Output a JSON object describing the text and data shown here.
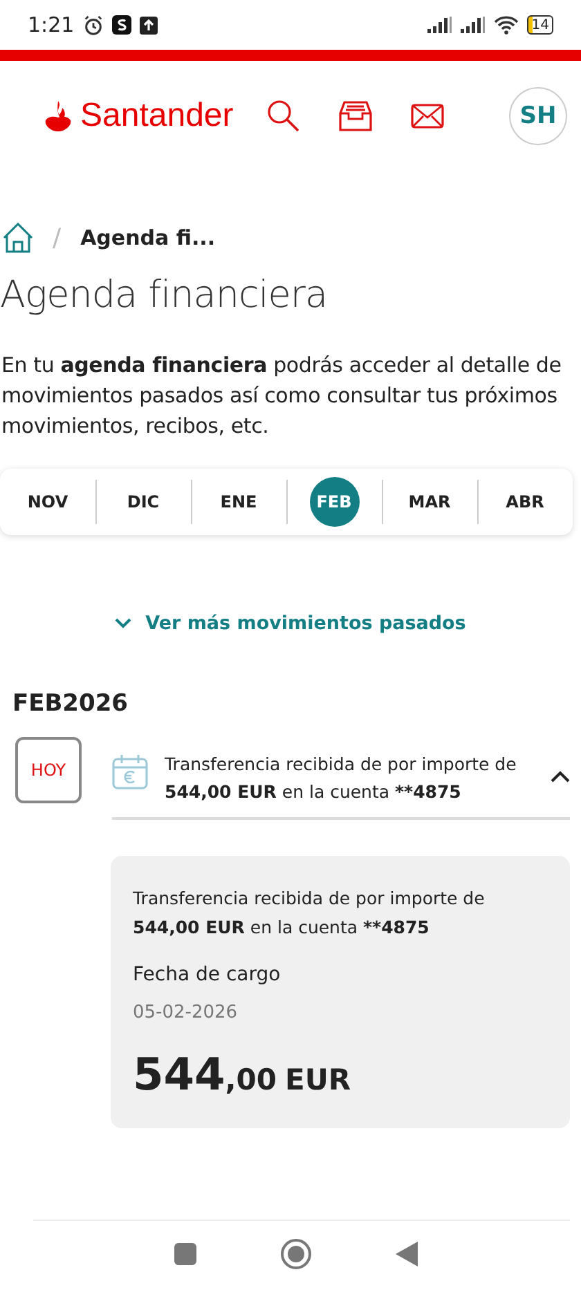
{
  "status_bar": {
    "time": "1:21",
    "battery": "14"
  },
  "header": {
    "brand": "Santander",
    "avatar": "SH"
  },
  "breadcrumb": {
    "separator": "/",
    "current": "Agenda fi..."
  },
  "title": "Agenda financiera",
  "intro": "En tu **agenda financiera** podrás acceder al detalle de movimientos pasados así como consultar tus próximos movimientos, recibos, etc.",
  "months": [
    {
      "label": "NOV",
      "selected": false
    },
    {
      "label": "DIC",
      "selected": false
    },
    {
      "label": "ENE",
      "selected": false
    },
    {
      "label": "FEB",
      "selected": true
    },
    {
      "label": "MAR",
      "selected": false
    },
    {
      "label": "ABR",
      "selected": false
    }
  ],
  "past_link": "Ver más movimientos pasados",
  "month_heading": "FEB2026",
  "movements": [
    {
      "day": "HOY",
      "summary": "Transferencia recibida de por importe de **544,00 EUR** en la cuenta ****4875**",
      "expanded": true,
      "detail": {
        "text": "Transferencia recibida de por importe de **544,00 EUR** en la cuenta ****4875**",
        "date_label": "Fecha de cargo",
        "date": "05-02-2026",
        "amount_integer": "544",
        "amount_decimals": ",00",
        "currency": "EUR"
      }
    }
  ]
}
